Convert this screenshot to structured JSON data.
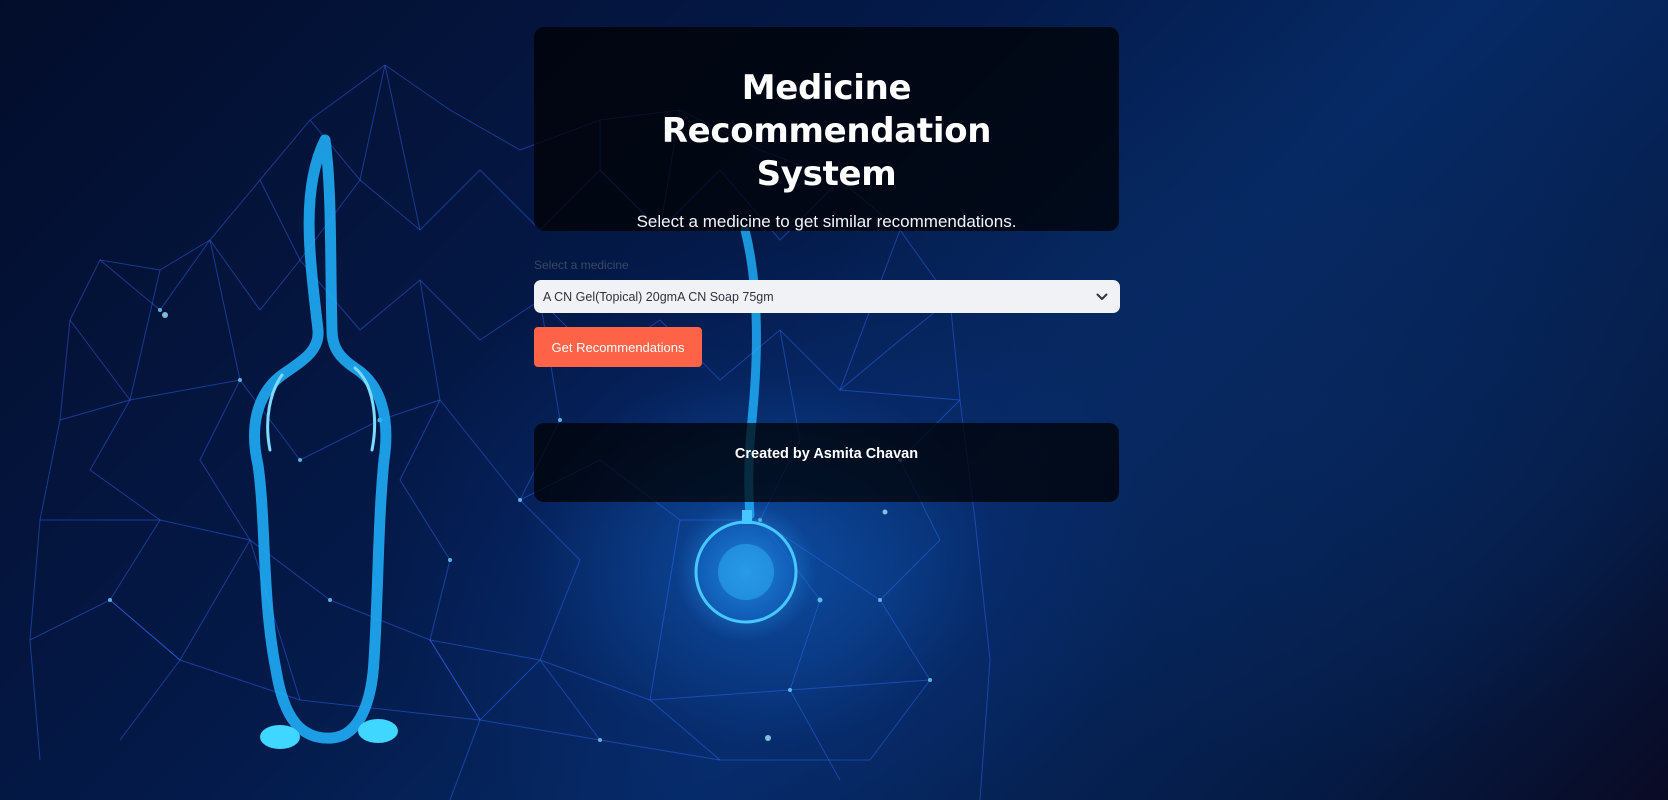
{
  "header": {
    "title": "Medicine Recommendation System",
    "subtitle": "Select a medicine to get similar recommendations."
  },
  "medicine_select": {
    "label": "Select a medicine",
    "selected_value": "A CN Gel(Topical) 20gmA CN Soap 75gm",
    "icon": "chevron-down-icon"
  },
  "actions": {
    "recommend_label": "Get Recommendations"
  },
  "footer": {
    "credit": "Created by Asmita Chavan"
  },
  "colors": {
    "accent_button": "#ff6347",
    "background": "#041a4a",
    "card": "#000000",
    "select_bg": "#f0f2f6",
    "illustration": "#21b4ff"
  }
}
